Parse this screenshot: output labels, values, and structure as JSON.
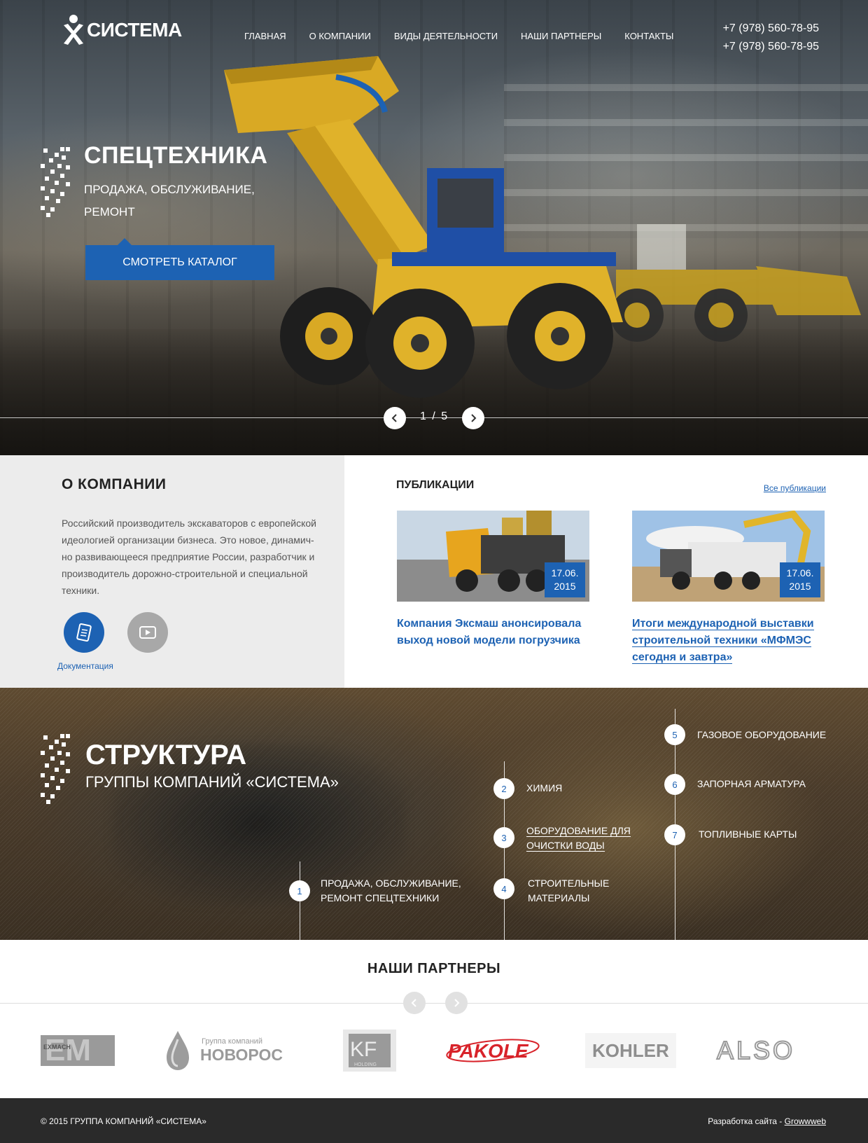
{
  "header": {
    "logo_text": "СИСТЕМА",
    "nav": [
      "ГЛАВНАЯ",
      "О КОМПАНИИ",
      "ВИДЫ ДЕЯТЕЛЬНОСТИ",
      "НАШИ ПАРТНЕРЫ",
      "КОНТАКТЫ"
    ],
    "phones": [
      "+7 (978) 560-78-95",
      "+7 (978) 560-78-95"
    ]
  },
  "hero": {
    "title": "СПЕЦТЕХНИКА",
    "subtitle": "ПРОДАЖА, ОБСЛУЖИВАНИЕ, РЕМОНТ",
    "cta": "СМОТРЕТЬ КАТАЛОГ",
    "slide_counter": "1 / 5"
  },
  "about": {
    "title": "О КОМПАНИИ",
    "text": "Российский производитель экскаваторов с европейской идеологией организации бизнеса. Это новое, динамич-но развивающееся предприятие России, разработчик и производитель дорожно-строительной и специальной техники.",
    "docs_label": "Документация"
  },
  "publications": {
    "title": "ПУБЛИКАЦИИ",
    "all_link": "Все публикации",
    "items": [
      {
        "date_day": "17.06.",
        "date_year": "2015",
        "title": "Компания Эксмаш анонсировала выход новой модели погрузчика"
      },
      {
        "date_day": "17.06.",
        "date_year": "2015",
        "title": "Итоги международной выставки строительной техники «МФМЭС сегодня и завтра»"
      }
    ]
  },
  "structure": {
    "title": "СТРУКТУРА",
    "subtitle": "ГРУППЫ КОМПАНИЙ «СИСТЕМА»",
    "items": [
      {
        "num": "1",
        "label_1": "ПРОДАЖА, ОБСЛУЖИВАНИЕ,",
        "label_2": "РЕМОНТ СПЕЦТЕХНИКИ"
      },
      {
        "num": "2",
        "label_1": "ХИМИЯ",
        "label_2": ""
      },
      {
        "num": "3",
        "label_1": "ОБОРУДОВАНИЕ ДЛЯ",
        "label_2": "ОЧИСТКИ ВОДЫ"
      },
      {
        "num": "4",
        "label_1": "СТРОИТЕЛЬНЫЕ",
        "label_2": "МАТЕРИАЛЫ"
      },
      {
        "num": "5",
        "label_1": "ГАЗОВОЕ ОБОРУДОВАНИЕ",
        "label_2": ""
      },
      {
        "num": "6",
        "label_1": "ЗАПОРНАЯ АРМАТУРА",
        "label_2": ""
      },
      {
        "num": "7",
        "label_1": "ТОПЛИВНЫЕ КАРТЫ",
        "label_2": ""
      }
    ]
  },
  "partners": {
    "title": "НАШИ ПАРТНЕРЫ",
    "logos": [
      "EXMACH",
      "Группа компаний",
      "НОВОРОС",
      "KF",
      "HOLDING",
      "PAKOLE",
      "KOHLER",
      "ALSO"
    ]
  },
  "footer": {
    "copyright": "© 2015 ГРУППА КОМПАНИЙ «СИСТЕМА»",
    "dev_prefix": "Разработка сайта - ",
    "dev_link": "Growwweb"
  },
  "colors": {
    "accent": "#1d62b3",
    "footer": "#2a2a2a",
    "about_bg": "#ececec"
  }
}
